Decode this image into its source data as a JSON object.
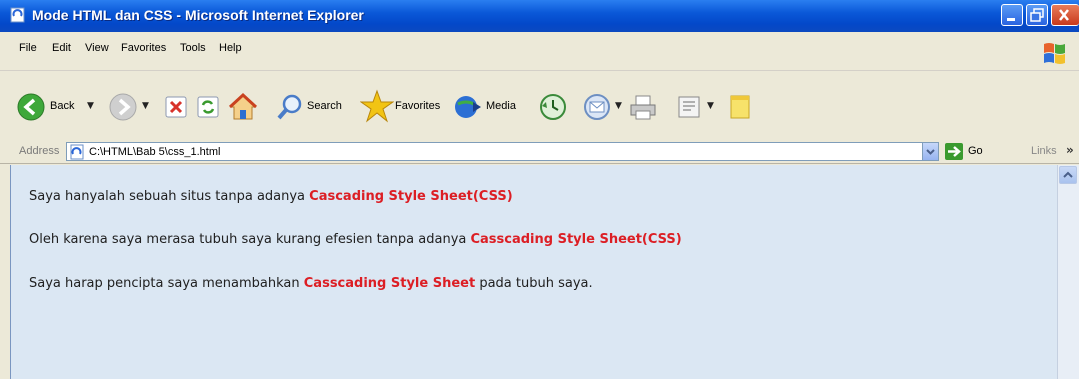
{
  "window": {
    "title": "Mode HTML dan CSS - Microsoft Internet Explorer"
  },
  "menu": [
    "File",
    "Edit",
    "View",
    "Favorites",
    "Tools",
    "Help"
  ],
  "toolbar": {
    "back_label": "Back",
    "search_label": "Search",
    "favorites_label": "Favorites",
    "media_label": "Media"
  },
  "address": {
    "label": "Address",
    "value": "C:\\HTML\\Bab 5\\css_1.html",
    "go_label": "Go",
    "links_label": "Links",
    "links_chevron": "»"
  },
  "content": {
    "p1": {
      "text": "Saya hanyalah sebuah situs tanpa adanya ",
      "highlight": "Cascading Style Sheet(CSS)"
    },
    "p2": {
      "text": "Oleh karena saya merasa tubuh saya kurang efesien tanpa adanya ",
      "highlight": "Casscading Style Sheet(CSS)"
    },
    "p3": {
      "text": "Saya harap pencipta saya menambahkan ",
      "highlight": "Casscading Style Sheet",
      "after": " pada tubuh saya."
    }
  },
  "colors": {
    "title_bar": "#0a58d8",
    "chrome": "#ece9d8",
    "content_bg": "#dbe7f3",
    "highlight": "#dc1e24"
  },
  "icons": [
    "ie-page-icon",
    "minimize-icon",
    "maximize-icon",
    "close-icon",
    "windows-logo-icon",
    "back-arrow-icon",
    "forward-arrow-icon",
    "stop-icon",
    "refresh-icon",
    "home-icon",
    "search-icon",
    "favorites-star-icon",
    "media-icon",
    "history-icon",
    "mail-icon",
    "print-icon",
    "edit-icon",
    "messenger-icon",
    "go-arrow-icon"
  ]
}
